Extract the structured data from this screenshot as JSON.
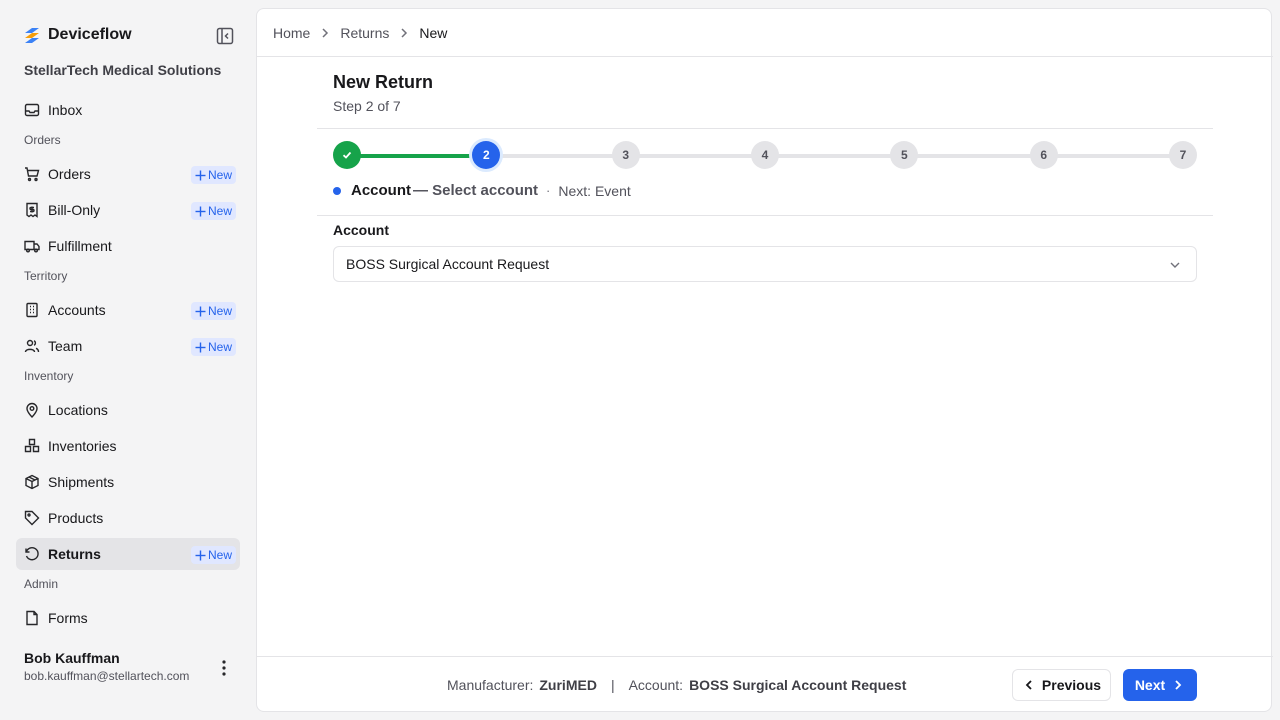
{
  "app": {
    "name": "Deviceflow",
    "org": "StellarTech Medical Solutions"
  },
  "sidebar": {
    "new_label": "New",
    "items": [
      {
        "label": "Inbox"
      },
      {
        "label": "Orders"
      },
      {
        "label": "Bill-Only"
      },
      {
        "label": "Fulfillment"
      },
      {
        "label": "Accounts"
      },
      {
        "label": "Team"
      },
      {
        "label": "Locations"
      },
      {
        "label": "Inventories"
      },
      {
        "label": "Shipments"
      },
      {
        "label": "Products"
      },
      {
        "label": "Returns"
      },
      {
        "label": "Forms"
      }
    ],
    "sections": {
      "orders": "Orders",
      "territory": "Territory",
      "inventory": "Inventory",
      "admin": "Admin"
    },
    "active": "Returns"
  },
  "user": {
    "name": "Bob Kauffman",
    "email": "bob.kauffman@stellartech.com"
  },
  "breadcrumb": [
    "Home",
    "Returns",
    "New"
  ],
  "page": {
    "title": "New Return",
    "subtitle": "Step 2 of 7"
  },
  "stepper": {
    "total": 7,
    "current": 2,
    "labels": [
      "1",
      "2",
      "3",
      "4",
      "5",
      "6",
      "7"
    ],
    "current_name": "Account",
    "current_desc": "— Select account",
    "separator": "·",
    "next": "Next: Event"
  },
  "form": {
    "account_label": "Account",
    "account_value": "BOSS Surgical Account Request"
  },
  "footer": {
    "manufacturer_label": "Manufacturer:",
    "manufacturer_value": "ZuriMED",
    "pipe": "|",
    "account_label": "Account:",
    "account_value": "BOSS Surgical Account Request",
    "previous": "Previous",
    "next": "Next"
  },
  "colors": {
    "accent": "#2563eb",
    "done": "#16a34a",
    "brand_orange": "#f59e0b",
    "brand_blue": "#3b82f6"
  }
}
